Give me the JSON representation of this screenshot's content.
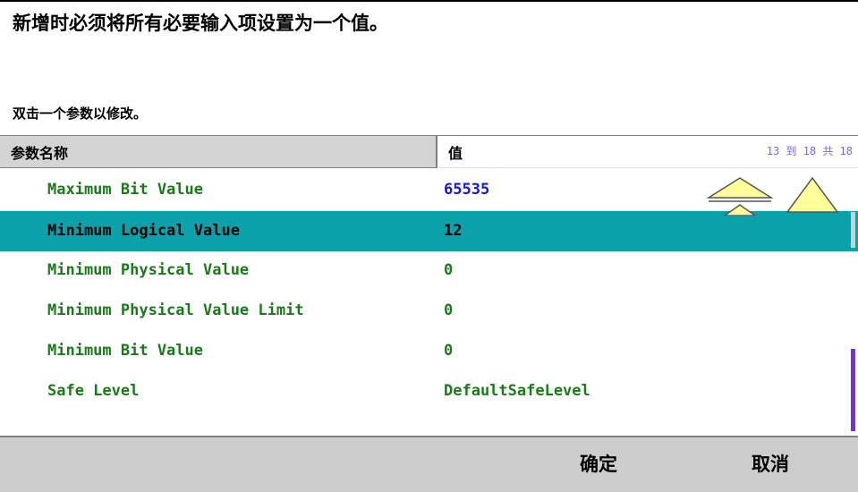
{
  "header": {
    "title": "新增时必须将所有必要输入项设置为一个值。",
    "hint": "双击一个参数以修改。"
  },
  "table": {
    "col_name": "参数名称",
    "col_value": "值",
    "pager": "13 到 18 共 18",
    "rows": [
      {
        "name": "Maximum Bit Value",
        "value": "65535"
      },
      {
        "name": "Minimum Logical Value",
        "value": "12"
      },
      {
        "name": "Minimum Physical Value",
        "value": "0"
      },
      {
        "name": "Minimum Physical Value Limit",
        "value": "0"
      },
      {
        "name": "Minimum Bit Value",
        "value": "0"
      },
      {
        "name": "Safe Level",
        "value": "DefaultSafeLevel"
      }
    ]
  },
  "footer": {
    "ok_label": "确定",
    "cancel_label": "取消"
  },
  "colors": {
    "selected_row": "#0aa1aa",
    "text_green": "#1a7a1a",
    "value_blue": "#1414e6",
    "footer_bg": "#cdcdcd",
    "scroll_thumb": "#7a2de0",
    "arrow_fill": "#ffff99"
  },
  "icons": [
    "page-up-arrow-icon",
    "scroll-up-arrow-icon"
  ]
}
